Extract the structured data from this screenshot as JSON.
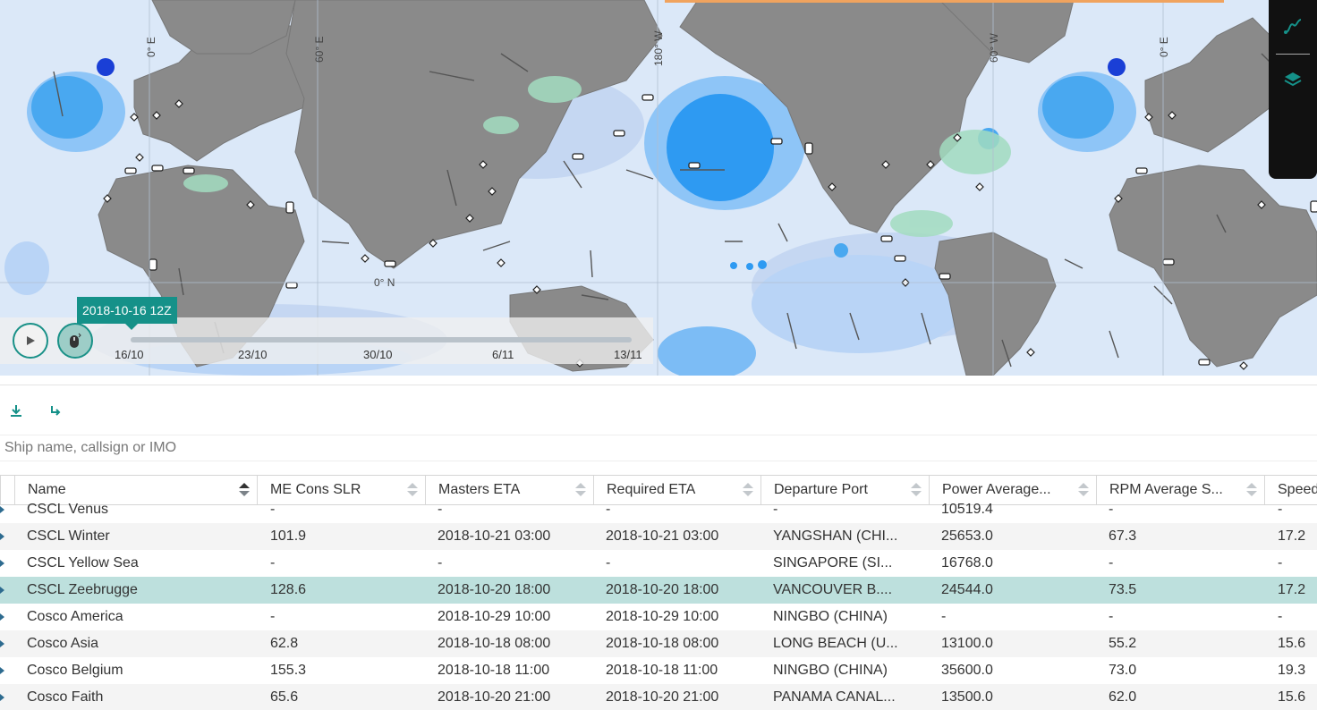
{
  "colors": {
    "accent": "#159189",
    "selected_row": "#bde0dd",
    "ocean": "#dbe8f8",
    "land": "#8c8c8c"
  },
  "map": {
    "graticule": {
      "lon_0": "0° E",
      "lon_60": "60° E",
      "lon_180": "180° W",
      "lon_60w": "60° W",
      "lon_0b": "0° E",
      "equator": "0° N"
    }
  },
  "side_panel": {
    "route_icon": "route-icon",
    "layers_icon": "layers-icon"
  },
  "timeline": {
    "current": "2018-10-16 12Z",
    "ticks": [
      "16/10",
      "23/10",
      "30/10",
      "6/11",
      "13/11"
    ]
  },
  "toolbar": {
    "download_icon": "download-icon",
    "reset_icon": "reset-icon"
  },
  "search": {
    "placeholder": "Ship name, callsign or IMO",
    "value": ""
  },
  "table": {
    "columns": [
      "Name",
      "ME Cons SLR",
      "Masters ETA",
      "Required ETA",
      "Departure Port",
      "Power Average...",
      "RPM Average S...",
      "Speed"
    ],
    "sort": {
      "column": "Name"
    },
    "rows": [
      [
        "CSCL Venus",
        "-",
        "-",
        "-",
        "-",
        "10519.4",
        "-",
        "-"
      ],
      [
        "CSCL Winter",
        "101.9",
        "2018-10-21 03:00",
        "2018-10-21 03:00",
        "YANGSHAN (CHI...",
        "25653.0",
        "67.3",
        "17.2"
      ],
      [
        "CSCL Yellow Sea",
        "-",
        "-",
        "-",
        "SINGAPORE (SI...",
        "16768.0",
        "-",
        "-"
      ],
      [
        "CSCL Zeebrugge",
        "128.6",
        "2018-10-20 18:00",
        "2018-10-20 18:00",
        "VANCOUVER B....",
        "24544.0",
        "73.5",
        "17.2"
      ],
      [
        "Cosco America",
        "-",
        "2018-10-29 10:00",
        "2018-10-29 10:00",
        "NINGBO (CHINA)",
        "-",
        "-",
        "-"
      ],
      [
        "Cosco Asia",
        "62.8",
        "2018-10-18 08:00",
        "2018-10-18 08:00",
        "LONG BEACH (U...",
        "13100.0",
        "55.2",
        "15.6"
      ],
      [
        "Cosco Belgium",
        "155.3",
        "2018-10-18 11:00",
        "2018-10-18 11:00",
        "NINGBO (CHINA)",
        "35600.0",
        "73.0",
        "19.3"
      ],
      [
        "Cosco Faith",
        "65.6",
        "2018-10-20 21:00",
        "2018-10-20 21:00",
        "PANAMA CANAL...",
        "13500.0",
        "62.0",
        "15.6"
      ]
    ],
    "selected_row": 3
  }
}
